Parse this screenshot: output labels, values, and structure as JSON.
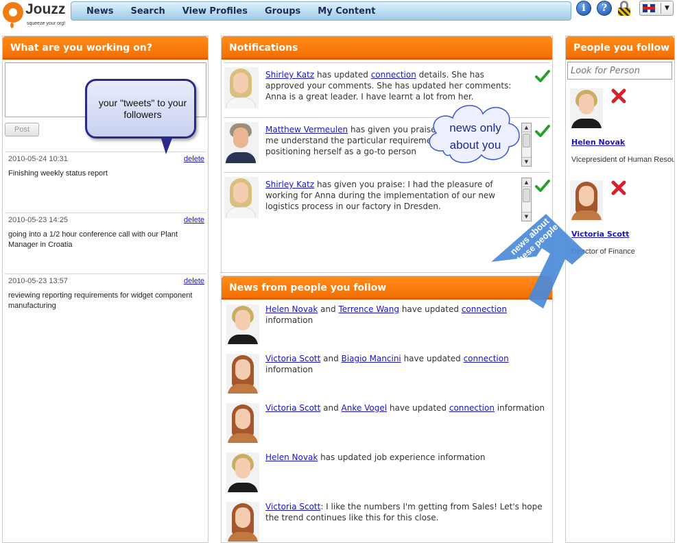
{
  "app": {
    "logo_name": "Jouzz",
    "logo_tagline": "squeeze your org!",
    "brand_color": "#f46c00",
    "nav_color": "#9ccbe9"
  },
  "nav": {
    "items": [
      {
        "label": "News"
      },
      {
        "label": "Search"
      },
      {
        "label": "View Profiles"
      },
      {
        "label": "Groups"
      },
      {
        "label": "My Content"
      }
    ]
  },
  "top_icons": {
    "info": "i",
    "help": "?",
    "lock_icon": "lock-icon",
    "language_flag": "uk-flag-icon",
    "dropdown_arrow": "▼"
  },
  "left_panel": {
    "title": "What are you working on?",
    "status_value": "",
    "post_label": "Post",
    "tweets": [
      {
        "date": "2010-05-24 10:31",
        "delete": "delete",
        "text": "Finishing weekly status report"
      },
      {
        "date": "2010-05-23 14:25",
        "delete": "delete",
        "text": "going into a 1/2 hour conference call with our Plant Manager in Croatia"
      },
      {
        "date": "2010-05-23 13:57",
        "delete": "delete",
        "text": "reviewing reporting requirements for widget component manufacturing"
      }
    ]
  },
  "notifications": {
    "title": "Notifications",
    "items": [
      {
        "person": "Shirley Katz",
        "pre": " has updated ",
        "link": "connection",
        "post": " details. She has approved your comments. She has updated her comments: Anna is a great leader. I have learnt a lot from her."
      },
      {
        "person": "Matthew Vermeulen",
        "pre": " has given you praise: Anna has helped me understand the particular requirements of businesses, positioning herself as a go-to person",
        "link": "",
        "post": ""
      },
      {
        "person": "Shirley Katz",
        "pre": " has given you praise: I had the pleasure of working for Anna during the implementation of our new logistics process in our factory in Dresden.",
        "link": "",
        "post": ""
      }
    ]
  },
  "news_panel": {
    "title": "News from people you follow",
    "items": [
      {
        "a": "Helen Novak",
        "and": " and ",
        "b": "Terrence Wang",
        "mid": " have updated ",
        "link": "connection",
        "post": " information"
      },
      {
        "a": "Victoria Scott",
        "and": " and ",
        "b": "Biagio Mancini",
        "mid": " have updated ",
        "link": "connection",
        "post": " information"
      },
      {
        "a": "Victoria Scott",
        "and": " and ",
        "b": "Anke Vogel",
        "mid": " have updated ",
        "link": "connection",
        "post": " information"
      },
      {
        "a": "Helen Novak",
        "and": "",
        "b": "",
        "mid": " has updated job experience information",
        "link": "",
        "post": ""
      },
      {
        "a": "Victoria Scott",
        "and": "",
        "b": "",
        "mid": ": I like the numbers I'm getting from Sales! Let's hope the trend continues like this for this close.",
        "link": "",
        "post": ""
      }
    ]
  },
  "right_panel": {
    "title": "People you follow",
    "search_placeholder": "Look for Person",
    "people": [
      {
        "name": "Helen Novak",
        "title": "Vicepresident of Human Resources"
      },
      {
        "name": "Victoria Scott",
        "title": "Director of Finance"
      }
    ]
  },
  "annotations": {
    "bubble_text": "your \"tweets\" to your followers",
    "cloud_text": "news only about you",
    "arrow_text": "news about these people"
  }
}
